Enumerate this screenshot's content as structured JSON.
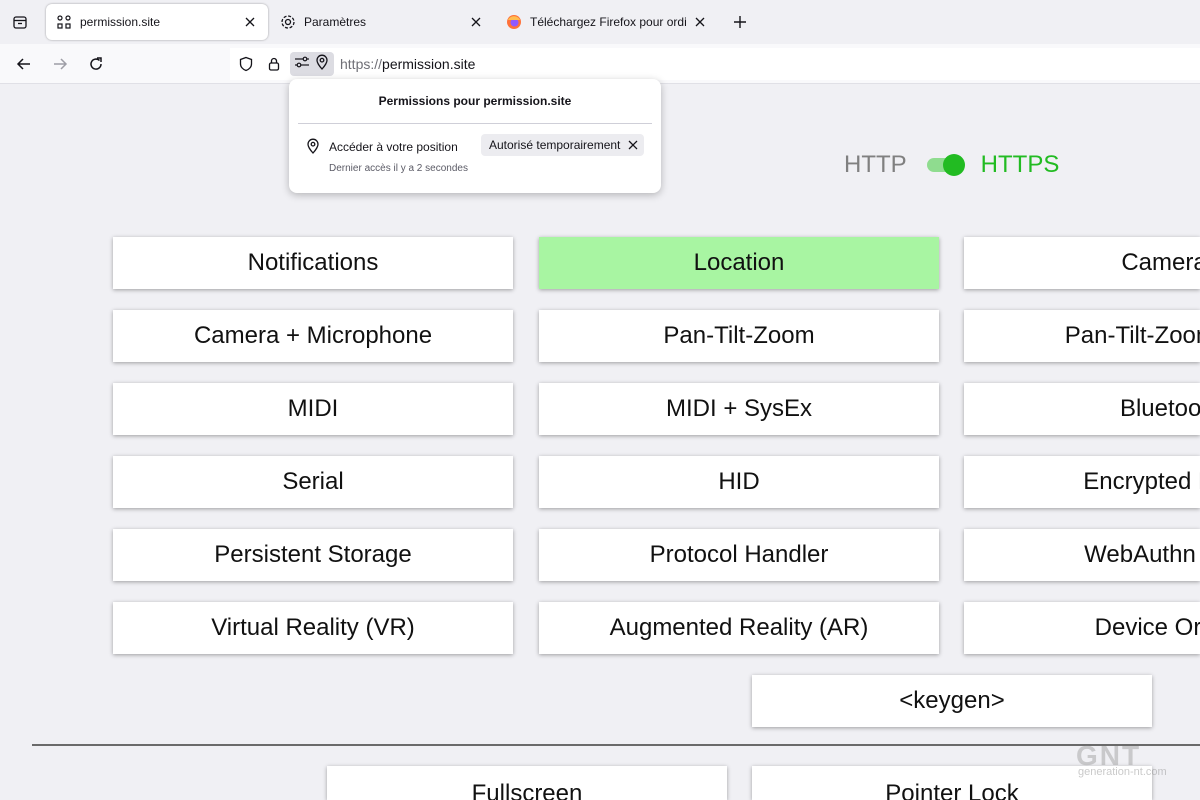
{
  "tabs": [
    {
      "label": "permission.site",
      "icon": "permission-site-icon",
      "active": true
    },
    {
      "label": "Paramètres",
      "icon": "gear-icon",
      "active": false
    },
    {
      "label": "Téléchargez Firefox pour ordinat",
      "icon": "firefox-icon",
      "active": false
    }
  ],
  "url": {
    "scheme": "https://",
    "host": "permission.site"
  },
  "popup": {
    "title": "Permissions pour permission.site",
    "permission_label": "Accéder à votre position",
    "permission_state": "Autorisé temporairement",
    "last_access": "Dernier accès il y a 2 secondes"
  },
  "protocol_toggle": {
    "left": "HTTP",
    "right": "HTTPS",
    "https_enabled": true
  },
  "buttons": [
    {
      "label": "Notifications"
    },
    {
      "label": "Location",
      "granted": true
    },
    {
      "label": "Camera"
    },
    {
      "label": "Camera + Microphone"
    },
    {
      "label": "Pan-Tilt-Zoom"
    },
    {
      "label": "Pan-Tilt-Zoom + M"
    },
    {
      "label": "MIDI"
    },
    {
      "label": "MIDI + SysEx"
    },
    {
      "label": "Bluetoot"
    },
    {
      "label": "Serial"
    },
    {
      "label": "HID"
    },
    {
      "label": "Encrypted Med"
    },
    {
      "label": "Persistent Storage"
    },
    {
      "label": "Protocol Handler"
    },
    {
      "label": "WebAuthn Atte"
    },
    {
      "label": "Virtual Reality (VR)"
    },
    {
      "label": "Augmented Reality (AR)"
    },
    {
      "label": "Device Orien"
    },
    {
      "label": "<keygen>"
    },
    {
      "label": "Fullscreen"
    },
    {
      "label": "Pointer Lock"
    }
  ],
  "watermark": {
    "logo": "GNT",
    "site": "generation-nt.com"
  },
  "colors": {
    "granted": "#a8f5a2",
    "https_green": "#22bb22",
    "http_gray": "#808080"
  }
}
